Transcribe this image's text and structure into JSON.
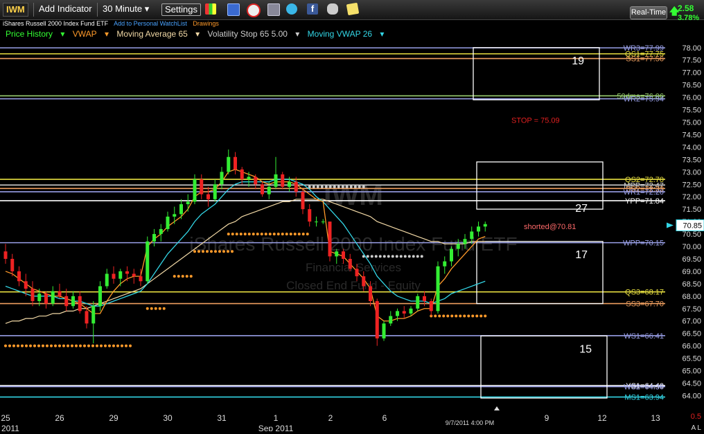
{
  "toolbar": {
    "symbol": "IWM",
    "add_indicator": "Add Indicator",
    "interval": "30 Minute",
    "settings": "Settings",
    "realtime": "Real-Time",
    "change": "2.58",
    "change_pct": "3.78%"
  },
  "subtitle": {
    "name": "iShares Russell 2000 Index Fund ETF",
    "watchlist": "Add to Personal WatchList",
    "drawings": "Drawings"
  },
  "legend": [
    {
      "label": "Price History",
      "color": "#3f3"
    },
    {
      "label": "VWAP",
      "color": "#ff9a2a"
    },
    {
      "label": "Moving Average 65",
      "color": "#f2d9a6"
    },
    {
      "label": "Volatility Stop 65 5.00",
      "color": "#cccccc"
    },
    {
      "label": "Moving VWAP 26",
      "color": "#33d6e6"
    }
  ],
  "watermark": {
    "symbol": "IWM",
    "name": "iShares Russell 2000 Index Fund ETF",
    "sector": "Financial Services",
    "category": "Closed End Fund - Equity"
  },
  "chart_data": {
    "type": "candlestick",
    "y_axis": {
      "min": 63.4,
      "max": 78.3,
      "ticks": [
        64.0,
        64.5,
        65.0,
        65.5,
        66.0,
        66.5,
        67.0,
        67.5,
        68.0,
        68.5,
        69.0,
        69.5,
        70.0,
        70.5,
        71.0,
        71.5,
        72.0,
        72.5,
        73.0,
        73.5,
        74.0,
        74.5,
        75.0,
        75.5,
        76.0,
        76.5,
        77.0,
        77.5,
        78.0
      ]
    },
    "last_price": "70.85",
    "x_labels": [
      "25",
      "26",
      "29",
      "30",
      "31",
      "1",
      "2",
      "6",
      "9",
      "12",
      "13"
    ],
    "month_labels": [
      "2011",
      "Sep 2011"
    ],
    "cursor_label": "9/7/2011 4:00 PM",
    "corner_value": "0.5",
    "corner_flags": "A L",
    "levels": [
      {
        "label": "WR3=77.99",
        "value": 77.99,
        "color": "#9aa0e8"
      },
      {
        "label": "QS1=77.75",
        "value": 77.75,
        "color": "#e8e040"
      },
      {
        "label": "SS1=77.56",
        "value": 77.56,
        "color": "#f0a060"
      },
      {
        "label": "50dma=76.06",
        "value": 76.06,
        "color": "#9ad070"
      },
      {
        "label": "WR2=75.94",
        "value": 75.94,
        "color": "#9aa0e8"
      },
      {
        "label": "STOP = 75.09",
        "value": 75.09,
        "color": "#e02020"
      },
      {
        "label": "QS2=72.70",
        "value": 72.7,
        "color": "#e8e040"
      },
      {
        "label": "MPP=72.47",
        "value": 72.47,
        "color": "#d0d0d0"
      },
      {
        "label": "SS2=72.33",
        "value": 72.33,
        "color": "#f0a060"
      },
      {
        "label": "WR1=72.20",
        "value": 72.2,
        "color": "#9aa0e8"
      },
      {
        "label": "YPP=71.84",
        "value": 71.84,
        "color": "#ffffff"
      },
      {
        "label": "WPP=70.15",
        "value": 70.15,
        "color": "#9aa0e8"
      },
      {
        "label": "QS3=68.17",
        "value": 68.17,
        "color": "#e8e040"
      },
      {
        "label": "SS3=67.70",
        "value": 67.7,
        "color": "#f0a060"
      },
      {
        "label": "WS1=66.41",
        "value": 66.41,
        "color": "#9aa0e8"
      },
      {
        "label": "YS1=64.40",
        "value": 64.4,
        "color": "#ffffff"
      },
      {
        "label": "WS2=64.36",
        "value": 64.36,
        "color": "#9aa0e8"
      },
      {
        "label": "MS1=63.94",
        "value": 63.94,
        "color": "#33d6e6"
      }
    ],
    "annotations": [
      {
        "label": "shorted@70.81",
        "value": 70.81,
        "color": "#ff6a6a"
      }
    ],
    "box_labels": [
      "19",
      "27",
      "17",
      "15"
    ],
    "candles": [
      [
        69.8,
        70.1,
        69.3,
        69.5
      ],
      [
        69.5,
        69.7,
        68.8,
        69.0
      ],
      [
        69.0,
        69.2,
        68.4,
        68.6
      ],
      [
        68.6,
        68.9,
        68.0,
        68.3
      ],
      [
        68.3,
        68.6,
        67.6,
        67.8
      ],
      [
        67.8,
        68.3,
        67.6,
        68.1
      ],
      [
        68.1,
        68.2,
        67.5,
        67.7
      ],
      [
        67.7,
        68.4,
        67.6,
        68.2
      ],
      [
        68.2,
        68.5,
        67.9,
        68.0
      ],
      [
        68.0,
        68.3,
        67.4,
        67.6
      ],
      [
        67.6,
        68.2,
        67.5,
        68.0
      ],
      [
        68.0,
        68.2,
        67.3,
        67.4
      ],
      [
        67.4,
        67.6,
        66.7,
        66.9
      ],
      [
        66.9,
        67.8,
        66.1,
        67.6
      ],
      [
        67.6,
        68.6,
        67.4,
        68.4
      ],
      [
        68.4,
        69.1,
        68.3,
        68.9
      ],
      [
        68.9,
        69.2,
        68.5,
        68.7
      ],
      [
        68.7,
        69.1,
        68.4,
        69.0
      ],
      [
        69.0,
        69.2,
        68.6,
        68.9
      ],
      [
        68.9,
        69.1,
        68.5,
        68.8
      ],
      [
        68.8,
        69.1,
        68.4,
        68.6
      ],
      [
        68.6,
        70.4,
        68.5,
        70.2
      ],
      [
        70.2,
        70.7,
        70.0,
        70.5
      ],
      [
        70.5,
        70.9,
        70.2,
        70.7
      ],
      [
        70.7,
        71.4,
        70.6,
        71.2
      ],
      [
        71.2,
        71.6,
        70.9,
        71.3
      ],
      [
        71.3,
        71.9,
        71.1,
        71.7
      ],
      [
        71.7,
        72.1,
        71.4,
        71.8
      ],
      [
        71.8,
        72.9,
        71.7,
        72.7
      ],
      [
        72.7,
        72.9,
        71.9,
        72.1
      ],
      [
        72.1,
        72.4,
        71.6,
        71.9
      ],
      [
        71.9,
        72.7,
        71.8,
        72.5
      ],
      [
        72.5,
        73.2,
        72.3,
        73.0
      ],
      [
        73.0,
        73.9,
        72.9,
        73.6
      ],
      [
        73.6,
        73.8,
        72.9,
        73.1
      ],
      [
        73.1,
        73.2,
        72.5,
        72.7
      ],
      [
        72.7,
        73.0,
        72.4,
        72.8
      ],
      [
        72.8,
        72.9,
        72.3,
        72.5
      ],
      [
        72.5,
        72.6,
        72.0,
        72.1
      ],
      [
        72.1,
        72.6,
        71.9,
        72.4
      ],
      [
        72.4,
        73.6,
        72.3,
        72.9
      ],
      [
        72.9,
        73.0,
        72.3,
        72.4
      ],
      [
        72.4,
        72.8,
        72.2,
        72.6
      ],
      [
        72.6,
        72.8,
        72.0,
        72.2
      ],
      [
        72.2,
        72.3,
        71.3,
        71.5
      ],
      [
        71.5,
        71.7,
        70.8,
        71.0
      ],
      [
        71.0,
        71.2,
        70.8,
        71.0
      ],
      [
        71.0,
        71.1,
        70.9,
        71.0
      ],
      [
        71.0,
        71.0,
        69.4,
        69.6
      ],
      [
        69.6,
        69.9,
        69.3,
        69.8
      ],
      [
        69.8,
        69.9,
        69.3,
        69.5
      ],
      [
        69.5,
        69.7,
        69.0,
        69.1
      ],
      [
        69.1,
        69.3,
        68.6,
        68.8
      ],
      [
        68.8,
        69.0,
        68.2,
        68.4
      ],
      [
        68.4,
        68.6,
        67.6,
        67.8
      ],
      [
        67.8,
        67.9,
        66.0,
        66.3
      ],
      [
        66.3,
        67.0,
        66.2,
        66.9
      ],
      [
        66.9,
        67.4,
        66.8,
        67.2
      ],
      [
        67.2,
        67.5,
        67.0,
        67.4
      ],
      [
        67.4,
        67.6,
        67.1,
        67.3
      ],
      [
        67.3,
        67.6,
        67.2,
        67.5
      ],
      [
        67.5,
        68.1,
        67.4,
        68.0
      ],
      [
        68.0,
        68.2,
        67.6,
        67.8
      ],
      [
        67.8,
        67.9,
        67.2,
        67.4
      ],
      [
        67.4,
        69.4,
        67.3,
        69.2
      ],
      [
        69.2,
        69.6,
        68.9,
        69.4
      ],
      [
        69.4,
        70.0,
        69.2,
        69.9
      ],
      [
        69.9,
        70.3,
        69.6,
        70.1
      ],
      [
        70.1,
        70.5,
        69.9,
        70.3
      ],
      [
        70.3,
        70.8,
        70.1,
        70.6
      ],
      [
        70.6,
        71.0,
        70.4,
        70.8
      ],
      [
        70.8,
        71.0,
        70.6,
        70.9
      ]
    ],
    "vwap": [
      69.0,
      68.9,
      68.7,
      68.5,
      68.3,
      68.2,
      68.1,
      68.0,
      68.0,
      67.9,
      67.8,
      67.7,
      67.5,
      67.3,
      67.3,
      67.8,
      68.2,
      68.5,
      68.7,
      68.8,
      68.8,
      70.0,
      70.3,
      70.5,
      70.8,
      71.0,
      71.2,
      71.5,
      72.0,
      72.2,
      72.2,
      72.3,
      72.6,
      73.0,
      73.1,
      73.0,
      72.9,
      72.8,
      72.6,
      72.5,
      72.6,
      72.6,
      72.6,
      72.5,
      72.3,
      72.1,
      71.9,
      71.8,
      69.8,
      69.7,
      69.6,
      69.3,
      69.0,
      68.7,
      68.3,
      67.2,
      67.0,
      67.0,
      67.1,
      67.1,
      67.2,
      67.4,
      67.5,
      67.5,
      68.4,
      68.7,
      69.1,
      69.4,
      69.7,
      70.0,
      70.3,
      70.4
    ],
    "mvwap": [
      68.4,
      68.3,
      68.2,
      68.1,
      68.0,
      68.0,
      68.0,
      68.0,
      67.9,
      67.9,
      67.8,
      67.8,
      67.7,
      67.6,
      67.6,
      67.7,
      67.8,
      67.9,
      68.0,
      68.1,
      68.2,
      68.5,
      68.9,
      69.3,
      69.7,
      70.0,
      70.3,
      70.6,
      71.0,
      71.3,
      71.5,
      71.7,
      72.0,
      72.3,
      72.5,
      72.6,
      72.6,
      72.6,
      72.6,
      72.6,
      72.7,
      72.7,
      72.7,
      72.6,
      72.5,
      72.3,
      72.0,
      71.8,
      71.5,
      71.2,
      70.9,
      70.5,
      70.1,
      69.7,
      69.3,
      68.8,
      68.5,
      68.2,
      68.0,
      67.9,
      67.8,
      67.8,
      67.8,
      67.7,
      67.8,
      67.9,
      68.1,
      68.2,
      68.3,
      68.4,
      68.5,
      68.6
    ],
    "ma65": [
      66.9,
      67.0,
      67.0,
      67.1,
      67.1,
      67.2,
      67.2,
      67.3,
      67.3,
      67.4,
      67.4,
      67.5,
      67.5,
      67.6,
      67.7,
      67.8,
      67.9,
      68.0,
      68.1,
      68.2,
      68.3,
      68.5,
      68.7,
      68.9,
      69.1,
      69.3,
      69.5,
      69.7,
      69.9,
      70.1,
      70.3,
      70.5,
      70.7,
      70.9,
      71.0,
      71.2,
      71.3,
      71.4,
      71.5,
      71.6,
      71.7,
      71.8,
      71.8,
      71.9,
      71.9,
      71.9,
      71.9,
      71.9,
      71.8,
      71.7,
      71.6,
      71.5,
      71.4,
      71.3,
      71.2,
      71.0,
      70.9,
      70.8,
      70.7,
      70.6,
      70.5,
      70.4,
      70.3,
      70.2,
      70.2,
      70.1,
      70.1,
      70.1,
      70.1,
      70.2,
      70.2,
      70.2
    ],
    "vstop": [
      {
        "i0": 0,
        "i1": 19,
        "value": 66.0,
        "color": "#ff9a2a"
      },
      {
        "i0": 21,
        "i1": 24,
        "value": 67.5,
        "color": "#ff9a2a"
      },
      {
        "i0": 25,
        "i1": 28,
        "value": 68.8,
        "color": "#ff9a2a"
      },
      {
        "i0": 28,
        "i1": 34,
        "value": 69.8,
        "color": "#ff9a2a"
      },
      {
        "i0": 33,
        "i1": 45,
        "value": 70.5,
        "color": "#ff9a2a"
      },
      {
        "i0": 45,
        "i1": 53,
        "value": 72.4,
        "color": "#cccccc"
      },
      {
        "i0": 53,
        "i1": 62,
        "value": 69.6,
        "color": "#cccccc"
      },
      {
        "i0": 63,
        "i1": 71,
        "value": 67.2,
        "color": "#ff9a2a"
      }
    ]
  }
}
